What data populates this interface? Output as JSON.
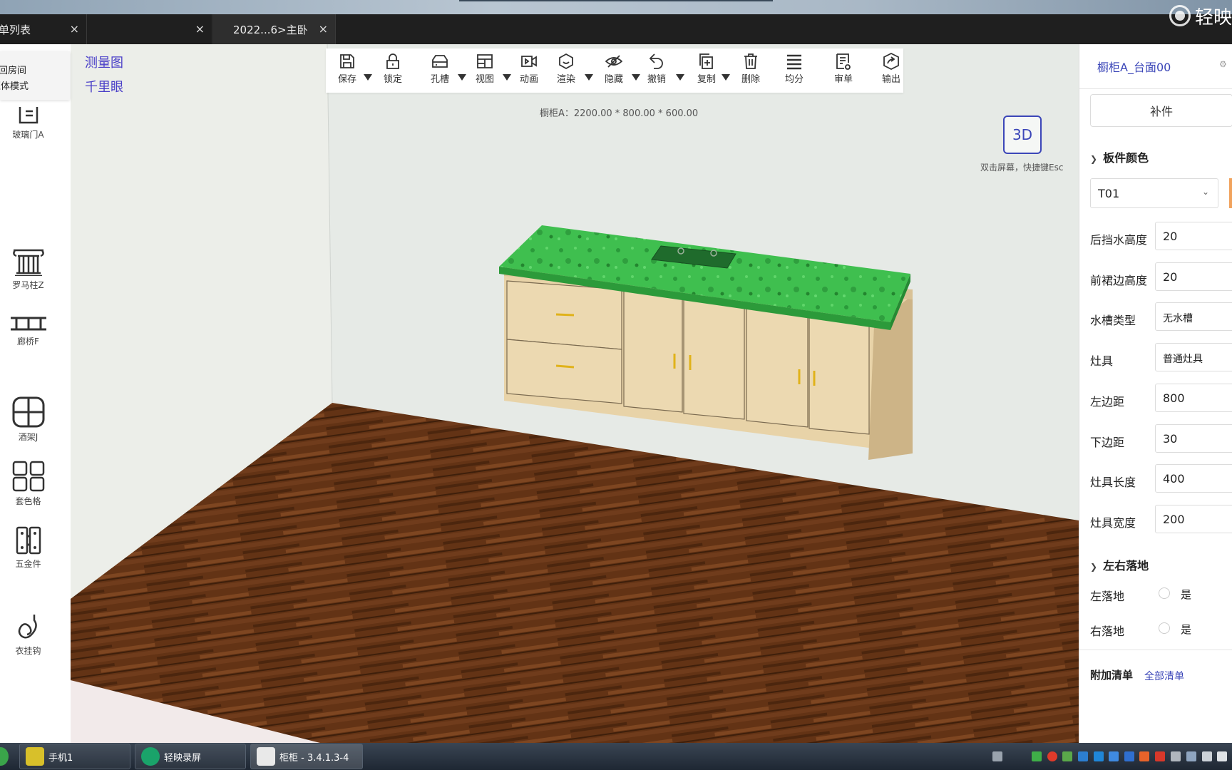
{
  "brand": {
    "text": "轻映"
  },
  "tabs": [
    {
      "label": "单列表"
    },
    {
      "label": ""
    },
    {
      "label": "2022...6>主卧"
    }
  ],
  "close_glyph": "×",
  "float_menu": {
    "item1": "回房间",
    "item2": "柜体模式"
  },
  "left_tools": [
    {
      "label": "玻璃门A",
      "icon": "glass-door-icon"
    },
    {
      "label": "罗马柱Z",
      "icon": "roman-column-icon"
    },
    {
      "label": "廊桥F",
      "icon": "bridge-icon"
    },
    {
      "label": "酒架J",
      "icon": "wine-rack-icon"
    },
    {
      "label": "套色格",
      "icon": "grid-icon"
    },
    {
      "label": "五金件",
      "icon": "hinge-icon"
    },
    {
      "label": "衣挂钩",
      "icon": "hook-icon"
    }
  ],
  "viewport": {
    "link_measure": "测量图",
    "link_eye": "千里眼",
    "dimension_label": "橱柜A：2200.00 * 800.00 * 600.00",
    "view_mode": "3D",
    "view_hint": "双击屏幕，快捷键Esc"
  },
  "toolbar": [
    {
      "label": "保存",
      "icon": "save-icon",
      "dropdown": true
    },
    {
      "label": "锁定",
      "icon": "lock-icon",
      "dropdown": false
    },
    {
      "label": "孔槽",
      "icon": "slot-icon",
      "dropdown": true
    },
    {
      "label": "视图",
      "icon": "view-icon",
      "dropdown": true
    },
    {
      "label": "动画",
      "icon": "video-icon",
      "dropdown": false
    },
    {
      "label": "渲染",
      "icon": "render-icon",
      "dropdown": true
    },
    {
      "label": "隐藏",
      "icon": "eye-off-icon",
      "dropdown": true
    },
    {
      "label": "撤销",
      "icon": "undo-icon",
      "dropdown": true
    },
    {
      "label": "复制",
      "icon": "copy-icon",
      "dropdown": true
    },
    {
      "label": "删除",
      "icon": "trash-icon",
      "dropdown": false
    },
    {
      "label": "均分",
      "icon": "menu-lines-icon",
      "dropdown": false
    },
    {
      "label": "审单",
      "icon": "audit-icon",
      "dropdown": false
    },
    {
      "label": "输出",
      "icon": "export-icon",
      "dropdown": false
    }
  ],
  "right_panel": {
    "title": "橱柜A_台面00",
    "gear": "⚙",
    "bujian": "补件",
    "section_color": "板件颜色",
    "color_value": "T01",
    "fields": [
      {
        "label": "后挡水高度",
        "value": "20"
      },
      {
        "label": "前裙边高度",
        "value": "20"
      },
      {
        "label": "水槽类型",
        "value": "无水槽"
      },
      {
        "label": "灶具",
        "value": "普通灶具"
      },
      {
        "label": "左边距",
        "value": "800"
      },
      {
        "label": "下边距",
        "value": "30"
      },
      {
        "label": "灶具长度",
        "value": "400"
      },
      {
        "label": "灶具宽度",
        "value": "200"
      }
    ],
    "section_floor": "左右落地",
    "radios": [
      {
        "label": "左落地",
        "option": "是"
      },
      {
        "label": "右落地",
        "option": "是"
      }
    ],
    "add_list": "附加清单",
    "all_list": "全部清单"
  },
  "taskbar": [
    {
      "label": "手机1"
    },
    {
      "label": "轻映录屏"
    },
    {
      "label": "柜柜 - 3.4.1.3-4"
    }
  ]
}
